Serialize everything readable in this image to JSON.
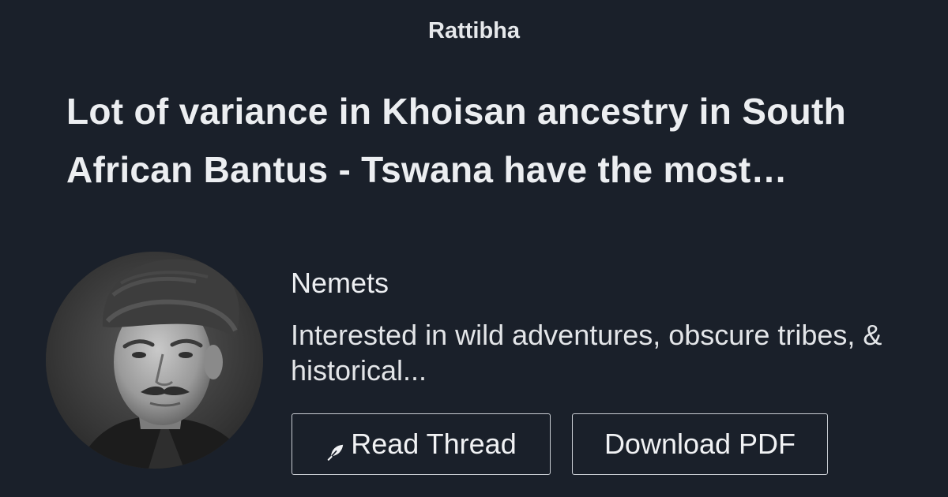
{
  "brand": "Rattibha",
  "thread": {
    "title": "Lot of variance in Khoisan ancestry in South African Bantus - Tswana have the most Khoisan ancestry"
  },
  "author": {
    "name": "Nemets",
    "bio": "Interested in wild adventures, obscure tribes, & historical..."
  },
  "actions": {
    "read_label": "Read Thread",
    "read_icon": "feather-icon",
    "pdf_label": "Download PDF"
  },
  "colors": {
    "background": "#1a202a",
    "text": "#eceef1",
    "button_border": "#c9cdd3"
  }
}
